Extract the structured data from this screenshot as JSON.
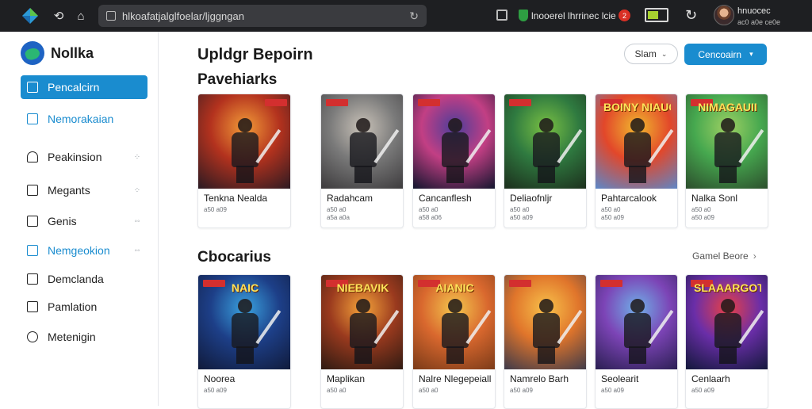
{
  "browser": {
    "url": "hlkoafatjalglfoelar/ljggngan",
    "extension_text": "lnooerel lhrrinec lcie",
    "badge_count": "2",
    "battery_level_percent": 60,
    "user_name": "hnuocec",
    "user_sub": "ac0 a0e ce0e"
  },
  "sidebar": {
    "brand": "Nollka",
    "items": [
      {
        "label": "Pencalcirn",
        "icon": "folder-icon",
        "state": "active"
      },
      {
        "label": "Nemorakaian",
        "icon": "square-icon",
        "state": "highlight"
      },
      {
        "label": "Peakinsion",
        "icon": "bell-icon",
        "state": "normal",
        "dots": "⁘"
      },
      {
        "label": "Megants",
        "icon": "folder-icon",
        "state": "normal",
        "dots": "⁘"
      },
      {
        "label": "Genis",
        "icon": "grid-icon",
        "state": "normal",
        "dots": "◦◦"
      },
      {
        "label": "Nemgeokion",
        "icon": "bookmark-icon",
        "state": "highlight",
        "dots": "◦◦"
      },
      {
        "label": "Demclanda",
        "icon": "monitor-icon",
        "state": "normal"
      },
      {
        "label": "Pamlation",
        "icon": "flag-icon",
        "state": "normal"
      },
      {
        "label": "Metenigin",
        "icon": "gear-icon",
        "state": "normal"
      }
    ]
  },
  "main": {
    "page_title": "Upldgr Bepoirn",
    "sort_label": "Slam",
    "primary_label": "Cencoairn",
    "sections": [
      {
        "title": "Pavehiarks",
        "cards": [
          {
            "title": "Tenkna Nealda",
            "meta": [
              "a50 a09"
            ],
            "colors": [
              "#f29b38",
              "#b3321e",
              "#2a1a22"
            ],
            "art": ""
          },
          {
            "title": "Radahcam",
            "meta": [
              "a50 a0",
              "a5a a0a"
            ],
            "colors": [
              "#c9c2b8",
              "#7a7a7a",
              "#3c3a3c"
            ],
            "art": ""
          },
          {
            "title": "Cancanflesh",
            "meta": [
              "a50 a0",
              "a58 a06"
            ],
            "colors": [
              "#4b3d9a",
              "#c23f84",
              "#10152d"
            ],
            "art": ""
          },
          {
            "title": "Deliaofnljr",
            "meta": [
              "a50 a0",
              "a50 a09"
            ],
            "colors": [
              "#79c043",
              "#2f7a40",
              "#1c2e1c"
            ],
            "art": ""
          },
          {
            "title": "Pahtarcalook",
            "meta": [
              "a50 a0",
              "a50 a09"
            ],
            "colors": [
              "#f0b92e",
              "#e2472a",
              "#5b87c9"
            ],
            "art": "BOINY NIAUCS"
          },
          {
            "title": "Nalka Sonl",
            "meta": [
              "a50 a0",
              "a50 a09"
            ],
            "colors": [
              "#9fd063",
              "#46a84f",
              "#2c4d2c"
            ],
            "art": "NIMAGAUII"
          }
        ]
      },
      {
        "title": "Cbocarius",
        "see_all": "Gamel Beore",
        "cards": [
          {
            "title": "Noorea",
            "meta": [
              "a50 a09"
            ],
            "colors": [
              "#3aa3e0",
              "#1d3f88",
              "#101a3a"
            ],
            "art": "NAIC"
          },
          {
            "title": "Maplikan",
            "meta": [
              "a50 a0"
            ],
            "colors": [
              "#f5a33a",
              "#9a3a1e",
              "#2e1a12"
            ],
            "art": "NIEBAVIK"
          },
          {
            "title": "Nalre Nlegepeiall",
            "meta": [
              "a50 a0"
            ],
            "colors": [
              "#f4c74d",
              "#d9682e",
              "#7a3a18"
            ],
            "art": "AIANIC"
          },
          {
            "title": "Namrelo Barh",
            "meta": [
              "a50 a09"
            ],
            "colors": [
              "#f8c14a",
              "#e0752b",
              "#3d3a4a"
            ],
            "art": ""
          },
          {
            "title": "Seolearit",
            "meta": [
              "a50 a09"
            ],
            "colors": [
              "#6fb0e8",
              "#7c44b6",
              "#2a1f52"
            ],
            "art": ""
          },
          {
            "title": "Cenlaarh",
            "meta": [
              "a50 a09"
            ],
            "colors": [
              "#e94045",
              "#6a2ea8",
              "#12183a"
            ],
            "art": "SLAAARGOTAI"
          }
        ]
      }
    ]
  }
}
